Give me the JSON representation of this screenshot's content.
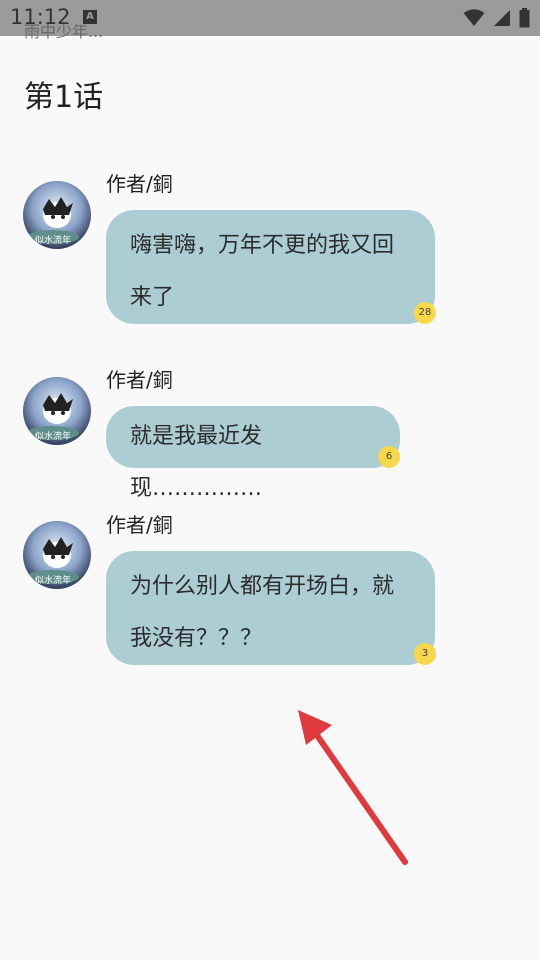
{
  "status_bar": {
    "time": "11:12",
    "overlay_text": "雨中少年..."
  },
  "chapter": {
    "title": "第1话"
  },
  "messages": [
    {
      "author": "作者/銅",
      "text": "嗨害嗨，万年不更的我又回来了",
      "comment_count": "28"
    },
    {
      "author": "作者/銅",
      "text": "就是我最近发现……………",
      "comment_count": "6"
    },
    {
      "author": "作者/銅",
      "text": "为什么别人都有开场白，就我没有？？？",
      "comment_count": "3"
    }
  ],
  "colors": {
    "bubble": "#adcdd5",
    "badge": "#f7d84a",
    "arrow": "#e03a3e",
    "status_bar": "#9b9b9b"
  }
}
